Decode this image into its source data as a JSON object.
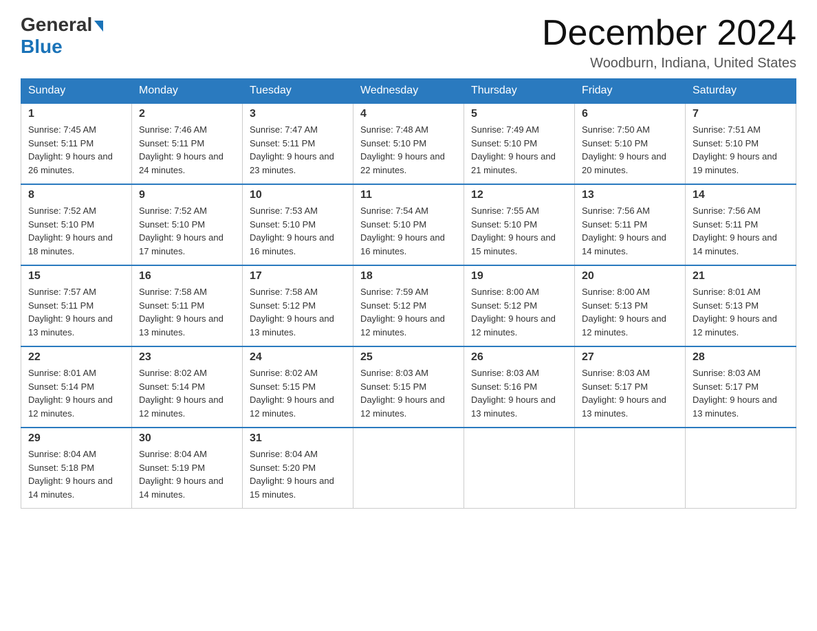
{
  "header": {
    "logo_line1": "General",
    "logo_line2": "Blue",
    "month_title": "December 2024",
    "location": "Woodburn, Indiana, United States"
  },
  "days_of_week": [
    "Sunday",
    "Monday",
    "Tuesday",
    "Wednesday",
    "Thursday",
    "Friday",
    "Saturday"
  ],
  "weeks": [
    [
      {
        "num": "1",
        "sunrise": "7:45 AM",
        "sunset": "5:11 PM",
        "daylight": "9 hours and 26 minutes."
      },
      {
        "num": "2",
        "sunrise": "7:46 AM",
        "sunset": "5:11 PM",
        "daylight": "9 hours and 24 minutes."
      },
      {
        "num": "3",
        "sunrise": "7:47 AM",
        "sunset": "5:11 PM",
        "daylight": "9 hours and 23 minutes."
      },
      {
        "num": "4",
        "sunrise": "7:48 AM",
        "sunset": "5:10 PM",
        "daylight": "9 hours and 22 minutes."
      },
      {
        "num": "5",
        "sunrise": "7:49 AM",
        "sunset": "5:10 PM",
        "daylight": "9 hours and 21 minutes."
      },
      {
        "num": "6",
        "sunrise": "7:50 AM",
        "sunset": "5:10 PM",
        "daylight": "9 hours and 20 minutes."
      },
      {
        "num": "7",
        "sunrise": "7:51 AM",
        "sunset": "5:10 PM",
        "daylight": "9 hours and 19 minutes."
      }
    ],
    [
      {
        "num": "8",
        "sunrise": "7:52 AM",
        "sunset": "5:10 PM",
        "daylight": "9 hours and 18 minutes."
      },
      {
        "num": "9",
        "sunrise": "7:52 AM",
        "sunset": "5:10 PM",
        "daylight": "9 hours and 17 minutes."
      },
      {
        "num": "10",
        "sunrise": "7:53 AM",
        "sunset": "5:10 PM",
        "daylight": "9 hours and 16 minutes."
      },
      {
        "num": "11",
        "sunrise": "7:54 AM",
        "sunset": "5:10 PM",
        "daylight": "9 hours and 16 minutes."
      },
      {
        "num": "12",
        "sunrise": "7:55 AM",
        "sunset": "5:10 PM",
        "daylight": "9 hours and 15 minutes."
      },
      {
        "num": "13",
        "sunrise": "7:56 AM",
        "sunset": "5:11 PM",
        "daylight": "9 hours and 14 minutes."
      },
      {
        "num": "14",
        "sunrise": "7:56 AM",
        "sunset": "5:11 PM",
        "daylight": "9 hours and 14 minutes."
      }
    ],
    [
      {
        "num": "15",
        "sunrise": "7:57 AM",
        "sunset": "5:11 PM",
        "daylight": "9 hours and 13 minutes."
      },
      {
        "num": "16",
        "sunrise": "7:58 AM",
        "sunset": "5:11 PM",
        "daylight": "9 hours and 13 minutes."
      },
      {
        "num": "17",
        "sunrise": "7:58 AM",
        "sunset": "5:12 PM",
        "daylight": "9 hours and 13 minutes."
      },
      {
        "num": "18",
        "sunrise": "7:59 AM",
        "sunset": "5:12 PM",
        "daylight": "9 hours and 12 minutes."
      },
      {
        "num": "19",
        "sunrise": "8:00 AM",
        "sunset": "5:12 PM",
        "daylight": "9 hours and 12 minutes."
      },
      {
        "num": "20",
        "sunrise": "8:00 AM",
        "sunset": "5:13 PM",
        "daylight": "9 hours and 12 minutes."
      },
      {
        "num": "21",
        "sunrise": "8:01 AM",
        "sunset": "5:13 PM",
        "daylight": "9 hours and 12 minutes."
      }
    ],
    [
      {
        "num": "22",
        "sunrise": "8:01 AM",
        "sunset": "5:14 PM",
        "daylight": "9 hours and 12 minutes."
      },
      {
        "num": "23",
        "sunrise": "8:02 AM",
        "sunset": "5:14 PM",
        "daylight": "9 hours and 12 minutes."
      },
      {
        "num": "24",
        "sunrise": "8:02 AM",
        "sunset": "5:15 PM",
        "daylight": "9 hours and 12 minutes."
      },
      {
        "num": "25",
        "sunrise": "8:03 AM",
        "sunset": "5:15 PM",
        "daylight": "9 hours and 12 minutes."
      },
      {
        "num": "26",
        "sunrise": "8:03 AM",
        "sunset": "5:16 PM",
        "daylight": "9 hours and 13 minutes."
      },
      {
        "num": "27",
        "sunrise": "8:03 AM",
        "sunset": "5:17 PM",
        "daylight": "9 hours and 13 minutes."
      },
      {
        "num": "28",
        "sunrise": "8:03 AM",
        "sunset": "5:17 PM",
        "daylight": "9 hours and 13 minutes."
      }
    ],
    [
      {
        "num": "29",
        "sunrise": "8:04 AM",
        "sunset": "5:18 PM",
        "daylight": "9 hours and 14 minutes."
      },
      {
        "num": "30",
        "sunrise": "8:04 AM",
        "sunset": "5:19 PM",
        "daylight": "9 hours and 14 minutes."
      },
      {
        "num": "31",
        "sunrise": "8:04 AM",
        "sunset": "5:20 PM",
        "daylight": "9 hours and 15 minutes."
      },
      null,
      null,
      null,
      null
    ]
  ]
}
